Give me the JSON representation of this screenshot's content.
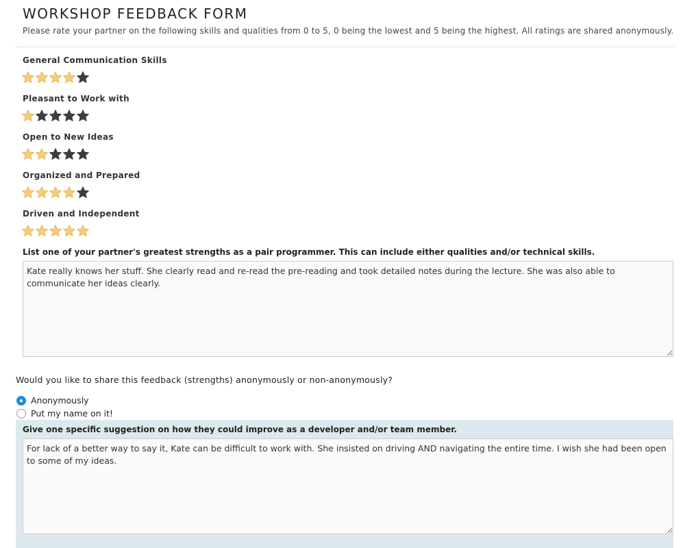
{
  "form": {
    "title": "WORKSHOP FEEDBACK FORM",
    "subtitle": "Please rate your partner on the following skills and qualities from 0 to 5, 0 being the lowest and 5 being the highest. All ratings are shared anonymously."
  },
  "colors": {
    "star_filled": "#f5cd79",
    "star_empty": "#3d3d3d",
    "radio_selected": "#1a8fe3",
    "panel_bg": "#dde9ef"
  },
  "ratings": [
    {
      "label": "General Communication Skills",
      "value": 4,
      "max": 5
    },
    {
      "label": "Pleasant to Work with",
      "value": 1,
      "max": 5
    },
    {
      "label": "Open to New Ideas",
      "value": 2,
      "max": 5
    },
    {
      "label": "Organized and Prepared",
      "value": 4,
      "max": 5
    },
    {
      "label": "Driven and Independent",
      "value": 5,
      "max": 5
    }
  ],
  "strengths": {
    "label": "List one of your partner's greatest strengths as a pair programmer. This can include either qualities and/or technical skills.",
    "value": "Kate really knows her stuff. She clearly read and re-read the pre-reading and took detailed notes during the lecture. She was also able to communicate her ideas clearly."
  },
  "share": {
    "question": "Would you like to share this feedback (strengths) anonymously or non-anonymously?",
    "options": [
      {
        "label": "Anonymously",
        "selected": true
      },
      {
        "label": "Put my name on it!",
        "selected": false
      }
    ]
  },
  "suggestion": {
    "label": "Give one specific suggestion on how they could improve as a developer and/or team member.",
    "value": "For lack of a better way to say it, Kate can be difficult to work with. She insisted on driving AND navigating the entire time. I wish she had been open to some of my ideas."
  }
}
